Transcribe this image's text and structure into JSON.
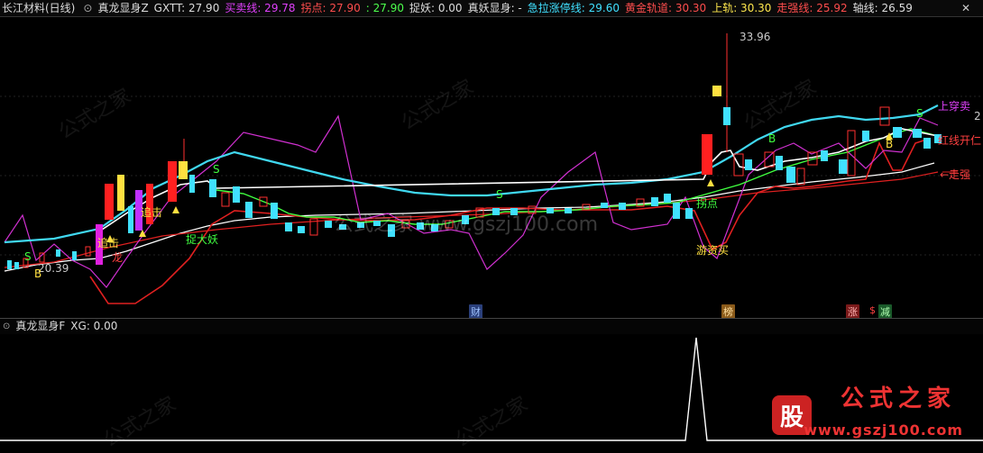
{
  "header": {
    "stock": "长江材料(日线)",
    "indicator": "真龙显身Z",
    "items": [
      {
        "label": "GXTT: 27.90",
        "color": "#dddddd"
      },
      {
        "label": "买卖线: 29.78",
        "color": "#e040fb"
      },
      {
        "label": "拐点: 27.90",
        "color": "#ff4d4d"
      },
      {
        "label": ": 27.90",
        "color": "#4dff4d"
      },
      {
        "label": "捉妖: 0.00",
        "color": "#dddddd"
      },
      {
        "label": "真妖显身: -",
        "color": "#dddddd"
      },
      {
        "label": "急拉涨停线: 29.60",
        "color": "#40e0ff"
      },
      {
        "label": "黄金轨道: 30.30",
        "color": "#ff4d4d"
      },
      {
        "label": "上轨: 30.30",
        "color": "#ffe84d"
      },
      {
        "label": "走强线: 25.92",
        "color": "#ff4d4d"
      },
      {
        "label": "轴线: 26.59",
        "color": "#dddddd"
      }
    ],
    "close_icon": "close-icon"
  },
  "main": {
    "high_label": "33.96",
    "low_label": "20.39",
    "right_axis_label": "2",
    "signals": {
      "zhuiji1": "追击",
      "zhuiji2": "追击",
      "long": "龙",
      "zhuoyao": "捉大妖",
      "guaidian": "拐点",
      "youzimai": "游资买",
      "shangchuan": "上穿卖",
      "hongxian": "红线开仁",
      "zouqiang": "←走强",
      "s1": "S",
      "b1": "B",
      "s2": "S",
      "s3": "S",
      "b2": "B",
      "b3": "B",
      "s4": "S"
    },
    "event_markers": [
      {
        "text": "财",
        "bg": "#2a3f7a",
        "color": "#9fc3ff"
      },
      {
        "text": "榜",
        "bg": "#8a5a1a",
        "color": "#ffe0a0"
      },
      {
        "text": "涨",
        "bg": "#7a1a1a",
        "color": "#ffb0b0"
      },
      {
        "text": "$",
        "bg": "#000000",
        "color": "#ff4040"
      },
      {
        "text": "减",
        "bg": "#1a5a2a",
        "color": "#b0ffb0"
      }
    ],
    "watermark_center": "公式之家 www.gszj100.com"
  },
  "sub": {
    "indicator": "真龙显身F",
    "value_label": "XG: 0.00"
  },
  "brand": {
    "logo_char": "股",
    "name": "公式之家",
    "url": "www.gszj100.com"
  },
  "colors": {
    "up": "#ff3030",
    "down": "#40e0ff",
    "magenta": "#d030d0",
    "cyan_line": "#40d8f0",
    "green_line": "#40ff40",
    "red_line": "#e02020",
    "white_line": "#ffffff"
  }
}
